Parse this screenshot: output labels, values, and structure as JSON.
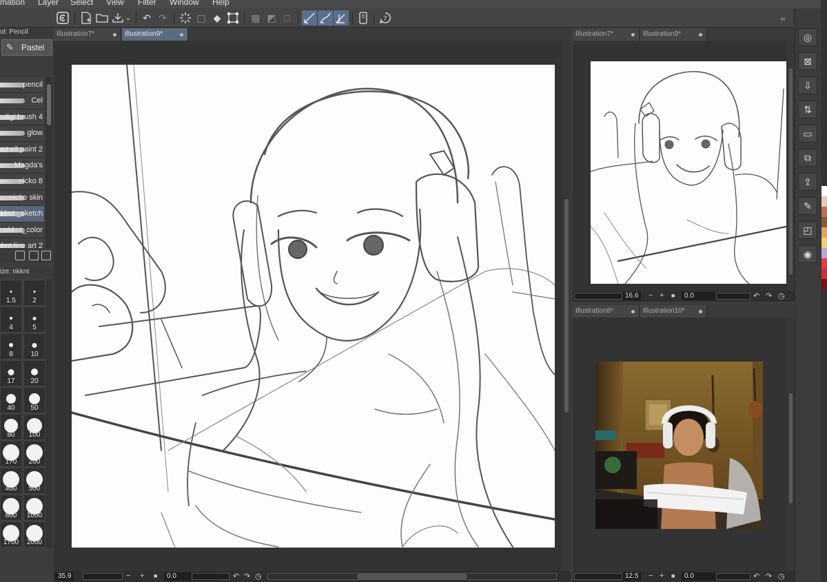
{
  "menu": {
    "items": [
      "mation",
      "Layer",
      "Select",
      "View",
      "Filter",
      "Window",
      "Help"
    ]
  },
  "tool_panel": {
    "header": "ol: Pencil",
    "sub_tool": "Pastel"
  },
  "brushes": [
    {
      "label": "pencil",
      "selected": false
    },
    {
      "label": "Cel",
      "selected": false
    },
    {
      "label": "digi brush 4",
      "selected": false
    },
    {
      "label": "glow",
      "selected": false
    },
    {
      "label": "ect oil paint 2",
      "selected": false
    },
    {
      "label": "Magda's",
      "selected": false
    },
    {
      "label": "nicko 8",
      "selected": false
    },
    {
      "label": "nicko skin",
      "selected": false
    },
    {
      "label": "kknt _sketch",
      "selected": true
    },
    {
      "label": "nkknt_color",
      "selected": false
    },
    {
      "label": "kknt line art 2",
      "selected": false
    }
  ],
  "size_panel": {
    "header": "ize: nkknt",
    "sizes": [
      "1.5",
      "2",
      "4",
      "5",
      "8",
      "10",
      "17",
      "20",
      "40",
      "50",
      "80",
      "100",
      "170",
      "200",
      "400",
      "500",
      "800",
      "1000",
      "1700",
      "2000"
    ]
  },
  "main": {
    "tabs": [
      {
        "label": "Illustration7*",
        "active": false
      },
      {
        "label": "Illustration9*",
        "active": true
      }
    ],
    "zoom": "35.9",
    "rotation": "0.0"
  },
  "sub1": {
    "tabs": [
      {
        "label": "Illustration7*",
        "active": false
      },
      {
        "label": "Illustration9*",
        "active": false
      }
    ],
    "zoom": "16.6",
    "rotation": "0.0"
  },
  "sub2": {
    "tabs": [
      {
        "label": "Illustration8*",
        "active": false
      },
      {
        "label": "Illustration10*",
        "active": false
      }
    ],
    "zoom": "12.5",
    "rotation": "0.0"
  },
  "status_controls": {
    "minus": "−",
    "plus": "+",
    "reset": "■",
    "rot_left": "↶",
    "rot_right": "↷",
    "rot_reset": "◷"
  },
  "right_icons": [
    "navigator-icon",
    "layer-property-icon",
    "import-icon",
    "layer-move-icon",
    "folder-icon",
    "layer-combine-icon",
    "layer-export-icon",
    "edit-icon",
    "object-icon",
    "target-icon"
  ],
  "colors": {
    "accent": "#5c6b80",
    "palette": [
      "#ffffff",
      "#e8c8b8",
      "#c07050",
      "#8a5a3a",
      "#e8a060",
      "#f0d070",
      "#c0a0e0",
      "#e04040",
      "#d03030",
      "#7a1010"
    ]
  }
}
